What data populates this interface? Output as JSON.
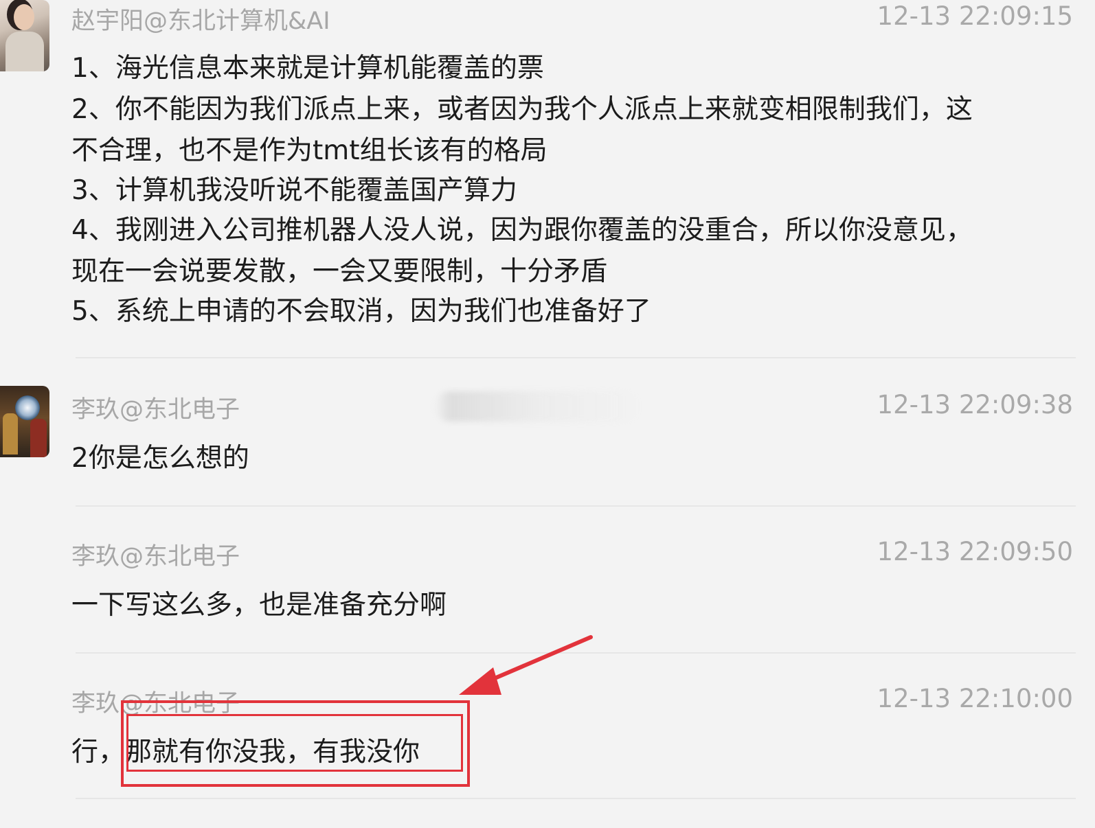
{
  "colors": {
    "background": "#f3f3f3",
    "sender_text": "#a7a7a7",
    "message_text": "#1c1c1c",
    "annotation_red": "#e2333b"
  },
  "messages": [
    {
      "sender": "赵宇阳@东北计算机&AI",
      "timestamp": "12-13 22:09:15",
      "avatar_icon": "portrait-woman-avatar",
      "lines": [
        "1、海光信息本来就是计算机能覆盖的票",
        "2、你不能因为我们派点上来，或者因为我个人派点上来就变相限制我们，这",
        "不合理，也不是作为tmt组长该有的格局",
        "3、计算机我没听说不能覆盖国产算力",
        "4、我刚进入公司推机器人没人说，因为跟你覆盖的没重合，所以你没意见，",
        "现在一会说要发散，一会又要限制，十分矛盾",
        "5、系统上申请的不会取消，因为我们也准备好了"
      ]
    },
    {
      "sender": "李玖@东北电子",
      "timestamp": "12-13 22:09:38",
      "avatar_icon": "painting-avatar",
      "lines": [
        "2你是怎么想的"
      ]
    },
    {
      "sender": "李玖@东北电子",
      "timestamp": "12-13 22:09:50",
      "lines": [
        "一下写这么多，也是准备充分啊"
      ]
    },
    {
      "sender": "李玖@东北电子",
      "timestamp": "12-13 22:10:00",
      "lines": [
        "行，那就有你没我，有我没你"
      ]
    }
  ],
  "annotation": {
    "type": "red-box-with-arrow",
    "icon": "red-arrow-icon"
  }
}
